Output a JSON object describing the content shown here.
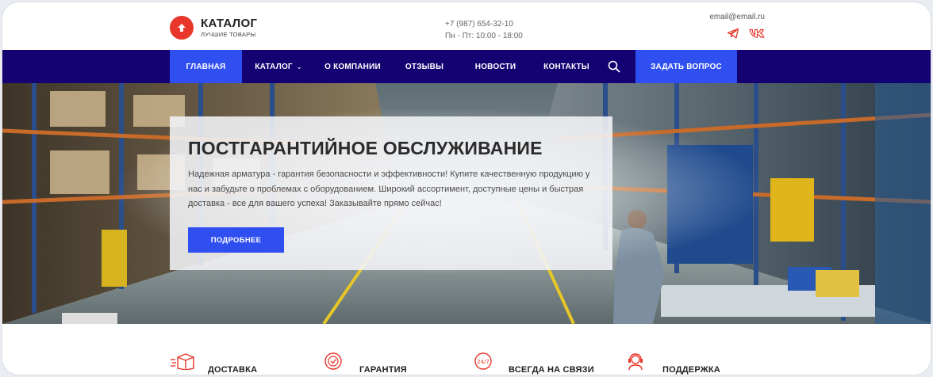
{
  "header": {
    "logo_title": "КАТАЛОГ",
    "logo_subtitle": "ЛУЧШИЕ ТОВАРЫ",
    "phone": "+7 (987) 654-32-10",
    "hours": "Пн - Пт: 10:00 - 18:00",
    "email": "email@email.ru",
    "socials": [
      "telegram-icon",
      "vk-icon"
    ]
  },
  "nav": {
    "items": [
      {
        "label": "ГЛАВНАЯ",
        "active": true
      },
      {
        "label": "КАТАЛОГ",
        "has_dropdown": true
      },
      {
        "label": "О КОМПАНИИ"
      },
      {
        "label": "ОТЗЫВЫ"
      },
      {
        "label": "НОВОСТИ"
      },
      {
        "label": "КОНТАКТЫ"
      }
    ],
    "search_icon": "search-icon",
    "ask_button": "ЗАДАТЬ ВОПРОС"
  },
  "hero": {
    "title": "ПОСТГАРАНТИЙНОЕ ОБСЛУЖИВАНИЕ",
    "text": "Надежная арматура - гарантия безопасности и эффективности! Купите качественную продукцию у нас и забудьте о проблемах с оборудованием. Широкий ассортимент, доступные цены и быстрая доставка - все для вашего успеха! Заказывайте прямо сейчас!",
    "button": "ПОДРОБНЕЕ"
  },
  "features": [
    {
      "label": "ДОСТАВКА",
      "icon": "delivery-box-icon"
    },
    {
      "label": "ГАРАНТИЯ",
      "icon": "guarantee-badge-icon"
    },
    {
      "label": "ВСЕГДА НА СВЯЗИ",
      "icon": "24-7-icon"
    },
    {
      "label": "ПОДДЕРЖКА",
      "icon": "support-headset-icon"
    }
  ],
  "colors": {
    "accent": "#2f4ff0",
    "nav_bg": "#140272",
    "logo_red": "#e8372a",
    "social_red": "#e8372a"
  }
}
